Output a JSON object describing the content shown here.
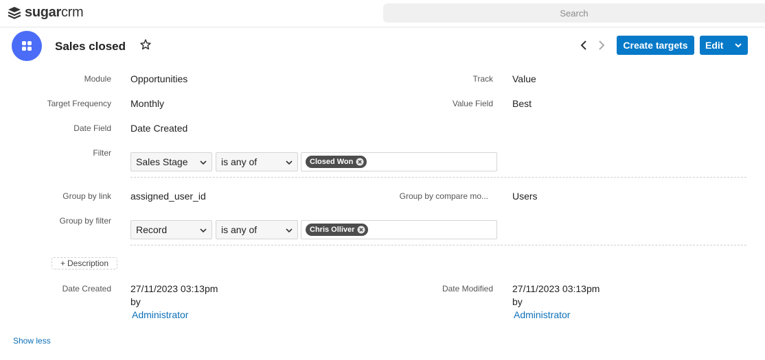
{
  "brand": {
    "name_bold": "sugar",
    "name_light": "crm"
  },
  "search": {
    "placeholder": "Search"
  },
  "record": {
    "title": "Sales closed",
    "create_targets_label": "Create targets",
    "edit_label": "Edit"
  },
  "fields": {
    "module": {
      "label": "Module",
      "value": "Opportunities"
    },
    "track": {
      "label": "Track",
      "value": "Value"
    },
    "target_frequency": {
      "label": "Target Frequency",
      "value": "Monthly"
    },
    "value_field": {
      "label": "Value Field",
      "value": "Best"
    },
    "date_field": {
      "label": "Date Field",
      "value": "Date Created"
    },
    "filter": {
      "label": "Filter",
      "field_select": "Sales Stage",
      "operator_select": "is any of",
      "pills": [
        "Closed Won"
      ]
    },
    "group_by_link": {
      "label": "Group by link",
      "value": "assigned_user_id"
    },
    "group_by_compare": {
      "label": "Group by compare mo...",
      "value": "Users"
    },
    "group_by_filter": {
      "label": "Group by filter",
      "field_select": "Record",
      "operator_select": "is any of",
      "pills": [
        "Chris Olliver"
      ]
    },
    "description_button": {
      "plus": "+",
      "label": "Description"
    },
    "date_created": {
      "label": "Date Created",
      "value": "27/11/2023 03:13pm",
      "by": "by",
      "user": "Administrator"
    },
    "date_modified": {
      "label": "Date Modified",
      "value": "27/11/2023 03:13pm",
      "by": "by",
      "user": "Administrator"
    }
  },
  "footer": {
    "show_less": "Show less"
  },
  "colors": {
    "accent": "#0679c8",
    "module_icon": "#4a6cf7",
    "link": "#0b6fb8",
    "pill": "#4d4d4d"
  },
  "icons": [
    "sugarcube-logo-icon",
    "module-icon",
    "star-icon",
    "chevron-left-icon",
    "chevron-right-icon",
    "chevron-down-icon",
    "remove-pill-icon"
  ]
}
